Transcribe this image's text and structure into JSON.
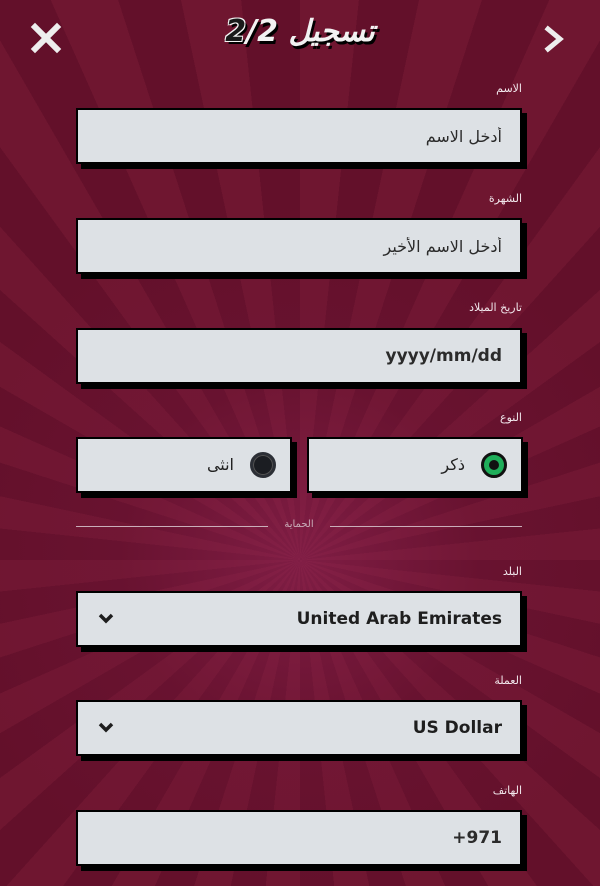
{
  "header": {
    "title_text": "تسجيل ",
    "step_current": "2",
    "step_sep": "/",
    "step_total": "2",
    "close_icon": "close-icon",
    "next_icon": "chevron-right-icon"
  },
  "form": {
    "first_name": {
      "label": "الاسم",
      "placeholder": "أدخل الاسم",
      "value": ""
    },
    "last_name": {
      "label": "الشهرة",
      "placeholder": "أدخل الاسم الأخير",
      "value": ""
    },
    "birth_date": {
      "label": "تاريخ الميلاد",
      "placeholder": "yyyy/mm/dd",
      "value": ""
    },
    "gender": {
      "label": "النوع",
      "options": [
        {
          "label": "ذكر",
          "selected": true
        },
        {
          "label": "انثى",
          "selected": false
        }
      ]
    },
    "divider_text": "الحماية",
    "country": {
      "label": "البلد",
      "value": "United Arab Emirates"
    },
    "currency": {
      "label": "العملة",
      "value": "US Dollar"
    },
    "phone": {
      "label": "الهاتف",
      "placeholder": "+971",
      "value": ""
    }
  },
  "colors": {
    "background": "#6a1330",
    "field_bg": "#dde1e5",
    "radio_selected": "#1fae5a"
  }
}
